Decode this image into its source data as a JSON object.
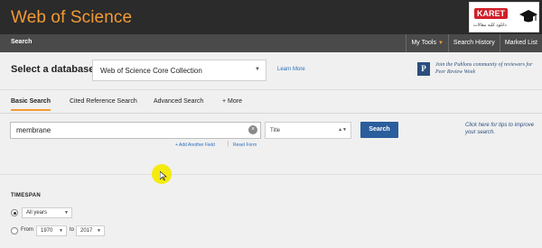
{
  "header": {
    "brand": "Web of Science",
    "logo_text": "KARET",
    "logo_sub": "دانلود کلیه مقالات"
  },
  "nav": {
    "search": "Search",
    "my_tools": "My Tools",
    "search_history": "Search History",
    "marked_list": "Marked List"
  },
  "database": {
    "label": "Select a database",
    "selected": "Web of Science Core Collection",
    "learn_more": "Learn More",
    "publons_icon": "P",
    "publons_text": "Join the Publons community of reviewers for Peer Review Week"
  },
  "tabs": [
    {
      "label": "Basic Search"
    },
    {
      "label": "Cited Reference Search"
    },
    {
      "label": "Advanced Search"
    },
    {
      "label": "+ More"
    }
  ],
  "search": {
    "query_value": "membrane",
    "field_selected": "Title",
    "button_label": "Search",
    "add_field": "+ Add Another Field",
    "separator": "|",
    "reset": "Reset Form",
    "tips": "Click here for tips to improve your search."
  },
  "timespan": {
    "label": "TIMESPAN",
    "all_years": "All years",
    "from_label": "From",
    "from_year": "1970",
    "to_label": "to",
    "to_year": "2017"
  },
  "icons": {
    "clear": "clear-icon",
    "dropdown": "chevron-down-icon",
    "cap": "graduation-cap-icon"
  },
  "colors": {
    "brand_orange": "#f39a34",
    "header_dark": "#2b2b2b",
    "nav_gray": "#4a4a4a",
    "button_blue": "#2a5e9c",
    "link_blue": "#2a6ebb",
    "highlight_yellow": "#f4ea10"
  }
}
